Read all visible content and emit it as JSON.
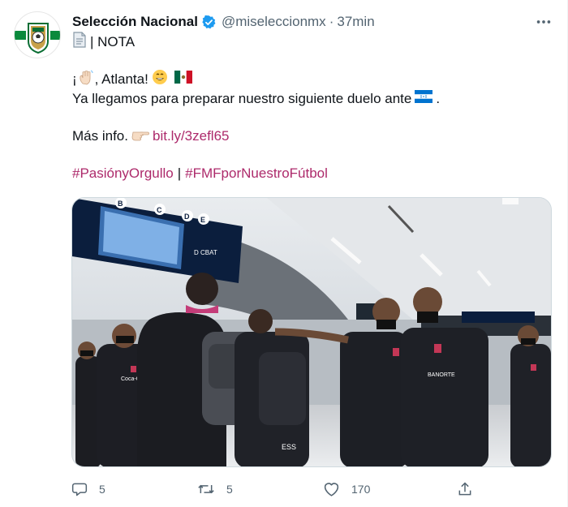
{
  "account": {
    "name": "Selección Nacional",
    "handle": "@miseleccionmx",
    "time": "37min"
  },
  "tweet": {
    "label": "| NOTA",
    "line1_prefix": "¡",
    "line1_text": ", Atlanta!",
    "line2": "Ya llegamos para preparar nuestro siguiente duelo ante",
    "line2_end": ".",
    "more_info": "Más info.",
    "link": "bit.ly/3zefl65",
    "hashtag1": "#PasiónyOrgullo",
    "separator": "|",
    "hashtag2": "#FMFporNuestroFútbol"
  },
  "media": {
    "kit_labels": [
      "Coca-Cola",
      "BANORTE",
      "ESS"
    ],
    "sign_letters": [
      "B",
      "C",
      "D",
      "E"
    ],
    "sign_text": "D CBAT"
  },
  "actions": {
    "replies": "5",
    "retweets": "5",
    "likes": "170"
  },
  "colors": {
    "link": "#ad2a6b",
    "verified": "#1d9bf0",
    "secondary_text": "#536471"
  }
}
